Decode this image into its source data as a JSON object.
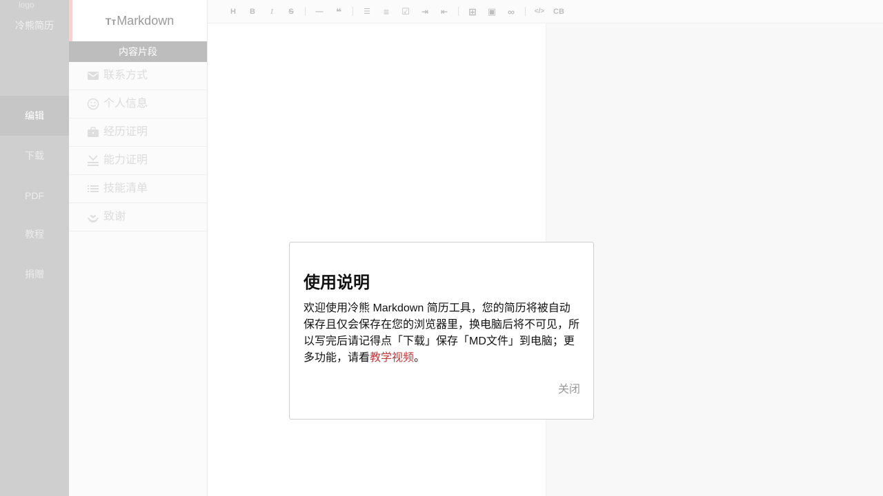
{
  "nav": {
    "logo_alt": "logo",
    "app_name": "冷熊简历",
    "items": [
      {
        "label": "编辑",
        "active": true
      },
      {
        "label": "下载",
        "active": false
      },
      {
        "label": "PDF",
        "active": false
      },
      {
        "label": "教程",
        "active": false
      },
      {
        "label": "捐赠",
        "active": false
      }
    ]
  },
  "snippets": {
    "header_icon": "Tт",
    "header_title": "Markdown",
    "section_title": "内容片段",
    "items": [
      {
        "icon": "mail-icon",
        "label": "联系方式"
      },
      {
        "icon": "smile-icon",
        "label": "个人信息"
      },
      {
        "icon": "briefcase-icon",
        "label": "经历证明"
      },
      {
        "icon": "award-icon",
        "label": "能力证明"
      },
      {
        "icon": "list-icon",
        "label": "技能清单"
      },
      {
        "icon": "heart-hand-icon",
        "label": "致谢"
      }
    ]
  },
  "toolbar": {
    "buttons": [
      {
        "name": "heading-icon",
        "glyph": "H"
      },
      {
        "name": "bold-icon",
        "glyph": "B"
      },
      {
        "name": "italic-icon",
        "glyph": "I"
      },
      {
        "name": "strikethrough-icon",
        "glyph": "S"
      },
      {
        "name": "horizontal-rule-icon",
        "glyph": "—"
      },
      {
        "name": "quote-icon",
        "glyph": "❝"
      },
      {
        "name": "bullet-list-icon",
        "glyph": "☰"
      },
      {
        "name": "numbered-list-icon",
        "glyph": "≡"
      },
      {
        "name": "checklist-icon",
        "glyph": "☑"
      },
      {
        "name": "indent-icon",
        "glyph": "⇥"
      },
      {
        "name": "outdent-icon",
        "glyph": "⇤"
      },
      {
        "name": "table-icon",
        "glyph": "⊞"
      },
      {
        "name": "image-icon",
        "glyph": "▣"
      },
      {
        "name": "link-icon",
        "glyph": "∞"
      },
      {
        "name": "code-icon",
        "glyph": "</>"
      },
      {
        "name": "code-block-icon",
        "glyph": "CB"
      }
    ]
  },
  "modal": {
    "title": "使用说明",
    "body_before": "欢迎使用冷熊 Markdown 简历工具，您的简历将被自动保存且仅会保存在您的浏览器里，换电脑后将不可见，所以写完后请记得点「下载」保存「MD文件」到电脑；更多功能，请看",
    "link_text": "教学视频",
    "body_after": "。",
    "close_label": "关闭"
  }
}
